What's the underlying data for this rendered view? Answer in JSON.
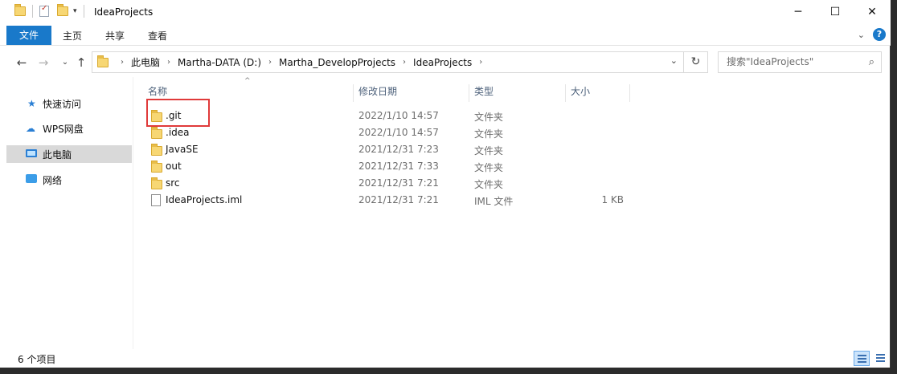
{
  "window": {
    "title": "IdeaProjects",
    "controls": {
      "minimize": "─",
      "maximize": "☐",
      "close": "✕"
    }
  },
  "ribbon": {
    "tabs": [
      "文件",
      "主页",
      "共享",
      "查看"
    ],
    "collapse_glyph": "⌄",
    "help_glyph": "?"
  },
  "navigation": {
    "back": "←",
    "forward": "→",
    "recent": "⌄",
    "up": "↑",
    "breadcrumb": [
      "此电脑",
      "Martha-DATA (D:)",
      "Martha_DevelopProjects",
      "IdeaProjects"
    ],
    "breadcrumb_separator": "›",
    "dropdown": "⌄",
    "refresh": "↻",
    "search_placeholder": "搜索\"IdeaProjects\"",
    "search_icon": "⌕"
  },
  "sidebar": {
    "items": [
      {
        "label": "快速访问",
        "icon": "star-icon",
        "selected": false
      },
      {
        "label": "WPS网盘",
        "icon": "cloud-icon",
        "selected": false
      },
      {
        "label": "此电脑",
        "icon": "computer-icon",
        "selected": true
      },
      {
        "label": "网络",
        "icon": "network-icon",
        "selected": false
      }
    ]
  },
  "list": {
    "columns": [
      "名称",
      "修改日期",
      "类型",
      "大小"
    ],
    "sort_glyph": "^",
    "rows": [
      {
        "name": ".git",
        "date": "2022/1/10 14:57",
        "type": "文件夹",
        "size": "",
        "icon": "folder-icon"
      },
      {
        "name": ".idea",
        "date": "2022/1/10 14:57",
        "type": "文件夹",
        "size": "",
        "icon": "folder-icon"
      },
      {
        "name": "JavaSE",
        "date": "2021/12/31 7:23",
        "type": "文件夹",
        "size": "",
        "icon": "folder-icon"
      },
      {
        "name": "out",
        "date": "2021/12/31 7:33",
        "type": "文件夹",
        "size": "",
        "icon": "folder-icon"
      },
      {
        "name": "src",
        "date": "2021/12/31 7:21",
        "type": "文件夹",
        "size": "",
        "icon": "folder-icon"
      },
      {
        "name": "IdeaProjects.iml",
        "date": "2021/12/31 7:21",
        "type": "IML 文件",
        "size": "1 KB",
        "icon": "file-icon"
      }
    ]
  },
  "status": {
    "item_count": "6 个项目"
  },
  "colors": {
    "accent": "#1979ca",
    "highlight_box": "#e03a3a",
    "selected_nav": "#d9d9d9"
  }
}
